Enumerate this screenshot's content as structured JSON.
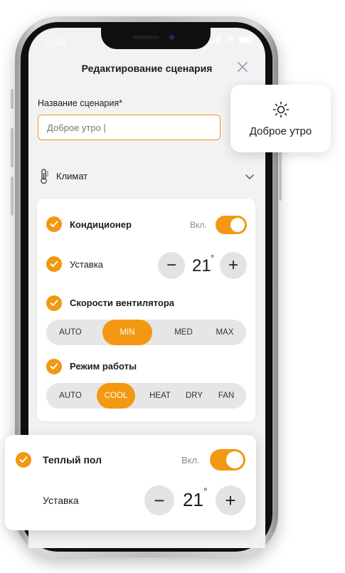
{
  "status": {
    "time": "11:10"
  },
  "sheet": {
    "title": "Редактирование сценария",
    "name_label": "Название сценария*",
    "name_value": "Доброе утро |",
    "climate_label": "Климат"
  },
  "ac": {
    "label": "Кондиционер",
    "on_label": "Вкл.",
    "setpoint_label": "Уставка",
    "temp": "21",
    "degree": "°",
    "minus": "−",
    "plus": "+",
    "fan_label": "Скорости вентилятора",
    "fan_options": [
      "AUTO",
      "MIN",
      "MED",
      "MAX"
    ],
    "fan_selected": "MIN",
    "mode_label": "Режим работы",
    "mode_options": [
      "AUTO",
      "COOL",
      "HEAT",
      "DRY",
      "FAN"
    ],
    "mode_selected": "COOL"
  },
  "popup": {
    "name": "Доброе утро",
    "icon": "sun-icon"
  },
  "floor": {
    "label": "Теплый пол",
    "on_label": "Вкл.",
    "setpoint_label": "Уставка",
    "temp": "21",
    "degree": "°",
    "minus": "−",
    "plus": "+"
  },
  "colors": {
    "accent": "#f29811",
    "background": "#f2f2f4",
    "chip": "#e6e6e8"
  }
}
